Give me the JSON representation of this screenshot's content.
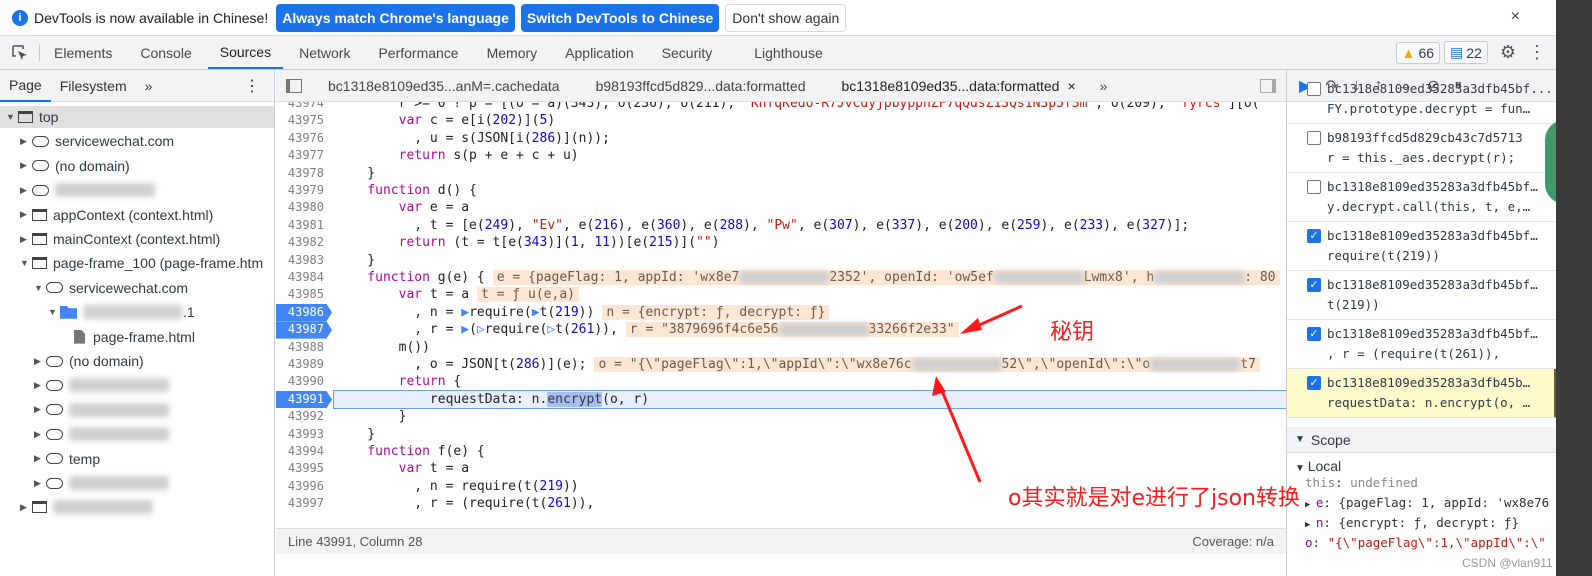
{
  "infobar": {
    "message": "DevTools is now available in Chinese!",
    "btn_match": "Always match Chrome's language",
    "btn_switch": "Switch DevTools to Chinese",
    "btn_dont_show": "Don't show again",
    "close": "×"
  },
  "tabs": [
    "Elements",
    "Console",
    "Sources",
    "Network",
    "Performance",
    "Memory",
    "Application",
    "Security",
    "Lighthouse"
  ],
  "active_tab": "Sources",
  "warnings": "66",
  "messages": "22",
  "left": {
    "tabs": [
      "Page",
      "Filesystem"
    ],
    "more": "»",
    "menu": "⋮",
    "tree": [
      {
        "label": "top",
        "icon": "frame",
        "depth": 0,
        "open": true,
        "sel": true
      },
      {
        "label": "servicewechat.com",
        "icon": "cloud",
        "depth": 1
      },
      {
        "label": "(no domain)",
        "icon": "cloud",
        "depth": 1
      },
      {
        "label": "",
        "icon": "cloud",
        "depth": 1,
        "blur": true
      },
      {
        "label": "appContext (context.html)",
        "icon": "frame",
        "depth": 1
      },
      {
        "label": "mainContext (context.html)",
        "icon": "frame",
        "depth": 1
      },
      {
        "label": "page-frame_100 (page-frame.htm",
        "icon": "frame",
        "depth": 1,
        "open": true
      },
      {
        "label": "servicewechat.com",
        "icon": "cloud",
        "depth": 2,
        "open": true
      },
      {
        "label": ".1",
        "icon": "folder",
        "depth": 3,
        "open": true,
        "blur": true
      },
      {
        "label": "page-frame.html",
        "icon": "file",
        "depth": 4
      },
      {
        "label": "(no domain)",
        "icon": "cloud",
        "depth": 2
      },
      {
        "label": "",
        "icon": "cloud",
        "depth": 2,
        "blur": true
      },
      {
        "label": "",
        "icon": "cloud",
        "depth": 2,
        "blur": true
      },
      {
        "label": "",
        "icon": "cloud",
        "depth": 2,
        "blur": true
      },
      {
        "label": "temp",
        "icon": "cloud",
        "depth": 2
      },
      {
        "label": "",
        "icon": "cloud",
        "depth": 2,
        "blur": true
      },
      {
        "label": "",
        "icon": "frame",
        "depth": 1,
        "blur": true
      }
    ]
  },
  "editor": {
    "tabs": [
      {
        "label": "bc1318e8109ed35...anM=.cachedata"
      },
      {
        "label": "b98193ffcd5d829...data:formatted"
      },
      {
        "label": "bc1318e8109ed35...data:formatted",
        "active": true,
        "close": "×"
      }
    ],
    "more": "»",
    "lines": [
      {
        "n": "43974",
        "t": [
          [
            "pl",
            "        r >= 0 ? p = [(o = a)(343), o(236), o(211), "
          ],
          [
            "str",
            "\"KnfqKedo-R7JvCdyjpbyppnZF7qQdsZ13Qs1N3p5f3m\""
          ],
          [
            "pl",
            ", o(209), "
          ],
          [
            "str",
            "\"fyrcs\""
          ],
          [
            "pl",
            "][o("
          ]
        ]
      },
      {
        "n": "43975",
        "t": [
          [
            "kw",
            "        var "
          ],
          [
            "pl",
            "c = e[i("
          ],
          [
            "num",
            "202"
          ],
          [
            "pl",
            ")]("
          ],
          [
            "num",
            "5"
          ],
          [
            "pl",
            ")"
          ]
        ]
      },
      {
        "n": "43976",
        "t": [
          [
            "pl",
            "          , u = s(JSON[i("
          ],
          [
            "num",
            "286"
          ],
          [
            "pl",
            ")](n));"
          ]
        ]
      },
      {
        "n": "43977",
        "t": [
          [
            "kw",
            "        return "
          ],
          [
            "pl",
            "s(p + e + c + u)"
          ]
        ]
      },
      {
        "n": "43978",
        "t": [
          [
            "pl",
            "    }"
          ]
        ]
      },
      {
        "n": "43979",
        "t": [
          [
            "kw",
            "    function "
          ],
          [
            "pl",
            "d() {"
          ]
        ]
      },
      {
        "n": "43980",
        "t": [
          [
            "kw",
            "        var "
          ],
          [
            "pl",
            "e = a"
          ]
        ]
      },
      {
        "n": "43981",
        "t": [
          [
            "pl",
            "          , t = [e("
          ],
          [
            "num",
            "249"
          ],
          [
            "pl",
            "), "
          ],
          [
            "str",
            "\"Ev\""
          ],
          [
            "pl",
            ", e("
          ],
          [
            "num",
            "216"
          ],
          [
            "pl",
            "), e("
          ],
          [
            "num",
            "360"
          ],
          [
            "pl",
            "), e("
          ],
          [
            "num",
            "288"
          ],
          [
            "pl",
            "), "
          ],
          [
            "str",
            "\"Pw\""
          ],
          [
            "pl",
            ", e("
          ],
          [
            "num",
            "307"
          ],
          [
            "pl",
            "), e("
          ],
          [
            "num",
            "337"
          ],
          [
            "pl",
            "), e("
          ],
          [
            "num",
            "200"
          ],
          [
            "pl",
            "), e("
          ],
          [
            "num",
            "259"
          ],
          [
            "pl",
            "), e("
          ],
          [
            "num",
            "233"
          ],
          [
            "pl",
            "), e("
          ],
          [
            "num",
            "327"
          ],
          [
            "pl",
            ")];"
          ]
        ]
      },
      {
        "n": "43982",
        "t": [
          [
            "kw",
            "        return "
          ],
          [
            "pl",
            "(t = t[e("
          ],
          [
            "num",
            "343"
          ],
          [
            "pl",
            ")]("
          ],
          [
            "num",
            "1"
          ],
          [
            "pl",
            ", "
          ],
          [
            "num",
            "11"
          ],
          [
            "pl",
            "))[e("
          ],
          [
            "num",
            "215"
          ],
          [
            "pl",
            ")]("
          ],
          [
            "str",
            "\"\""
          ],
          [
            "pl",
            ")"
          ]
        ]
      },
      {
        "n": "43983",
        "t": [
          [
            "pl",
            "    }"
          ]
        ]
      },
      {
        "n": "43984",
        "t": [
          [
            "kw",
            "    function "
          ],
          [
            "pl",
            "g(e) {"
          ]
        ],
        "inl": [
          "e = {pageFlag: 1, appId: 'wx8e7",
          "#",
          "2352', openId: 'ow5ef",
          "#",
          "Lwmx8', h",
          "#",
          ": 80"
        ]
      },
      {
        "n": "43985",
        "t": [
          [
            "kw",
            "        var "
          ],
          [
            "pl",
            "t = a"
          ]
        ],
        "inl": [
          "t = ƒ u(e,a)"
        ]
      },
      {
        "n": "43986",
        "bp": true,
        "t": [
          [
            "pl",
            "          , n = "
          ],
          [
            "bpm",
            "▶"
          ],
          [
            "pl",
            "require("
          ],
          [
            "bpm",
            "▶"
          ],
          [
            "pl",
            "t("
          ],
          [
            "num",
            "219"
          ],
          [
            "pl",
            "))"
          ]
        ],
        "inl": [
          "n = {encrypt: ƒ, decrypt: ƒ}"
        ]
      },
      {
        "n": "43987",
        "bp": true,
        "t": [
          [
            "pl",
            "          , r = "
          ],
          [
            "bpm",
            "▶"
          ],
          [
            "pl",
            "("
          ],
          [
            "bpm",
            "▷"
          ],
          [
            "pl",
            "require("
          ],
          [
            "bpm",
            "▷"
          ],
          [
            "pl",
            "t("
          ],
          [
            "num",
            "261"
          ],
          [
            "pl",
            ")),"
          ]
        ],
        "inl": [
          "r = \"3879696f4c6e56",
          "#",
          "33266f2e33\""
        ]
      },
      {
        "n": "43988",
        "t": [
          [
            "pl",
            "        m())"
          ]
        ]
      },
      {
        "n": "43989",
        "t": [
          [
            "pl",
            "          , o = JSON[t("
          ],
          [
            "num",
            "286"
          ],
          [
            "pl",
            ")](e);"
          ]
        ],
        "inl": [
          "o = \"{\\\"pageFlag\\\":1,\\\"appId\\\":\\\"wx8e76c",
          "#",
          "52\\\",\\\"openId\\\":\\\"o",
          "#",
          "t7"
        ]
      },
      {
        "n": "43990",
        "t": [
          [
            "kw",
            "        return "
          ],
          [
            "pl",
            "{"
          ]
        ]
      },
      {
        "n": "43991",
        "bp": true,
        "current": true,
        "t": [
          [
            "pl",
            "            requestData: n."
          ],
          [
            "hl",
            "encrypt"
          ],
          [
            "pl",
            "(o, r)"
          ]
        ]
      },
      {
        "n": "43992",
        "t": [
          [
            "pl",
            "        }"
          ]
        ]
      },
      {
        "n": "43993",
        "t": [
          [
            "pl",
            "    }"
          ]
        ]
      },
      {
        "n": "43994",
        "t": [
          [
            "kw",
            "    function "
          ],
          [
            "pl",
            "f(e) {"
          ]
        ]
      },
      {
        "n": "43995",
        "t": [
          [
            "kw",
            "        var "
          ],
          [
            "pl",
            "t = a"
          ]
        ]
      },
      {
        "n": "43996",
        "t": [
          [
            "pl",
            "          , n = require(t("
          ],
          [
            "num",
            "219"
          ],
          [
            "pl",
            "))"
          ]
        ]
      },
      {
        "n": "43997",
        "t": [
          [
            "pl",
            "          , r = (require(t("
          ],
          [
            "num",
            "261"
          ],
          [
            "pl",
            ")),"
          ]
        ]
      }
    ],
    "status_position": "Line 43991, Column 28",
    "status_coverage": "Coverage: n/a"
  },
  "right": {
    "breakpoints": [
      {
        "file": "bc1318e8109ed35283a3dfb45bf...",
        "code": "FY.prototype.decrypt = fun…",
        "checked": false
      },
      {
        "file": "b98193ffcd5d829cb43c7d5713",
        "code": "r = this._aes.decrypt(r);",
        "checked": false
      },
      {
        "file": "bc1318e8109ed35283a3dfb45bf…",
        "code": "y.decrypt.call(this, t, e,…",
        "checked": false
      },
      {
        "file": "bc1318e8109ed35283a3dfb45bf…",
        "code": "require(t(219))",
        "checked": true
      },
      {
        "file": "bc1318e8109ed35283a3dfb45bf…",
        "code": "t(219))",
        "checked": true
      },
      {
        "file": "bc1318e8109ed35283a3dfb45bf…",
        "code": ", r = (require(t(261)),",
        "checked": true
      },
      {
        "file": "bc1318e8109ed35283a3dfb45b…",
        "code": "requestData: n.encrypt(o, …",
        "checked": true,
        "current": true
      }
    ],
    "scope_title": "Scope",
    "local_title": "Local",
    "scope": [
      {
        "key": "this",
        "val": "undefined"
      },
      {
        "key": "e",
        "val": "{pageFlag: 1, appId: 'wx8e76"
      },
      {
        "key": "n",
        "val": "{encrypt: ƒ, decrypt: ƒ}"
      },
      {
        "key": "o",
        "val": "\"{\\\"pageFlag\\\":1,\\\"appId\\\":\\\""
      }
    ]
  },
  "annotations": {
    "key_label": "秘钥",
    "json_label": "o其实就是对e进行了json转换",
    "color": "#ff1a1a"
  },
  "watermark": "CSDN @vlan911"
}
